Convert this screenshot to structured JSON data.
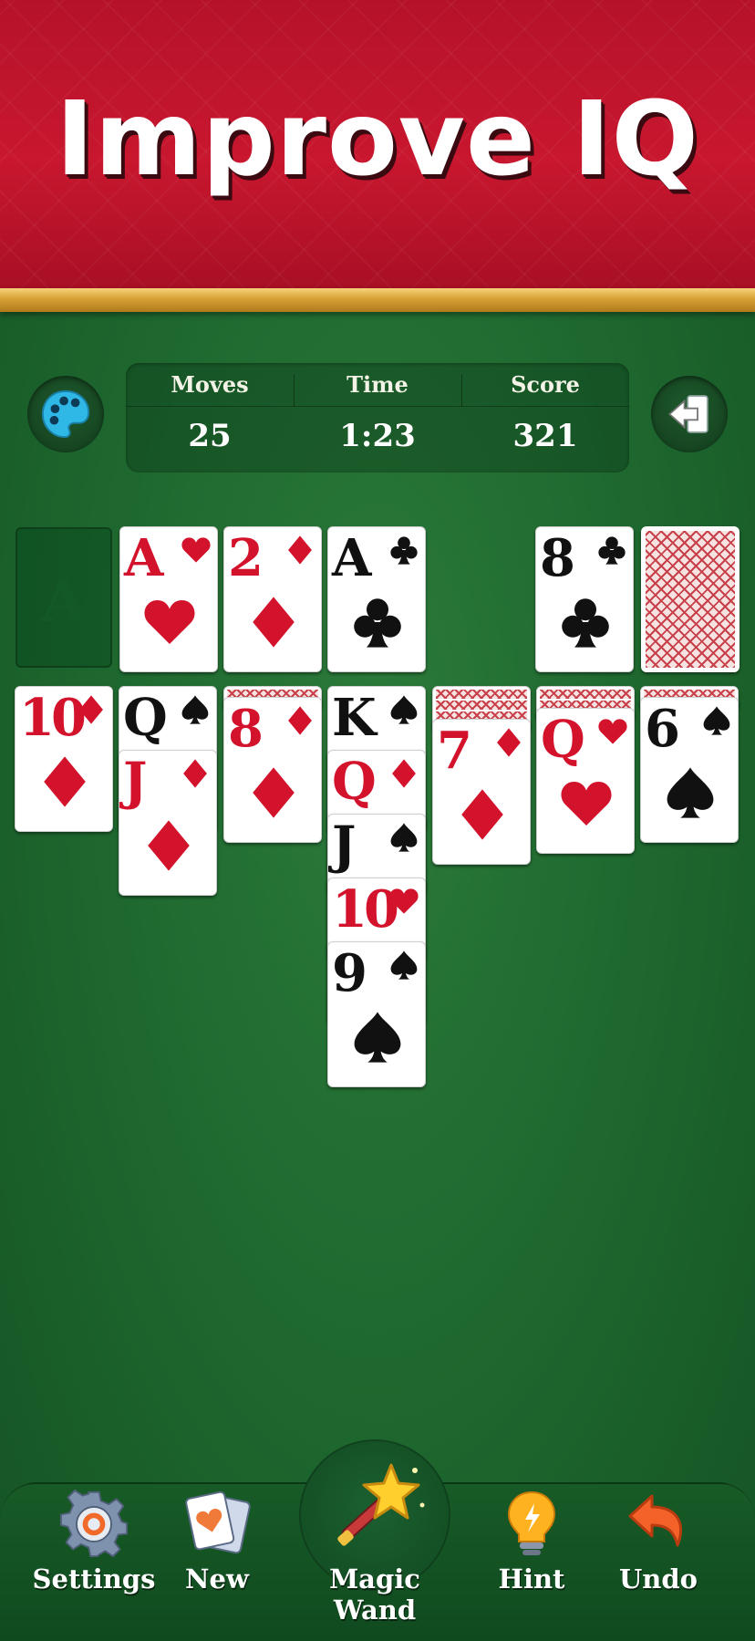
{
  "banner": {
    "title": "Improve IQ"
  },
  "stats": {
    "moves_label": "Moves",
    "moves_value": "25",
    "time_label": "Time",
    "time_value": "1:23",
    "score_label": "Score",
    "score_value": "321"
  },
  "foundation_placeholder": "A",
  "foundations": [
    {
      "rank": "A",
      "suit": "hearts"
    },
    {
      "rank": "2",
      "suit": "diamonds"
    },
    {
      "rank": "A",
      "suit": "clubs"
    }
  ],
  "waste_card": {
    "rank": "8",
    "suit": "clubs"
  },
  "tableau": [
    {
      "column": 1,
      "face_down": 0,
      "cards": [
        {
          "rank": "10",
          "suit": "diamonds"
        }
      ]
    },
    {
      "column": 2,
      "face_down": 0,
      "cards": [
        {
          "rank": "Q",
          "suit": "spades"
        },
        {
          "rank": "J",
          "suit": "diamonds"
        }
      ]
    },
    {
      "column": 3,
      "face_down": 1,
      "cards": [
        {
          "rank": "8",
          "suit": "diamonds"
        }
      ]
    },
    {
      "column": 4,
      "face_down": 0,
      "cards": [
        {
          "rank": "K",
          "suit": "spades"
        },
        {
          "rank": "Q",
          "suit": "diamonds"
        },
        {
          "rank": "J",
          "suit": "spades"
        },
        {
          "rank": "10",
          "suit": "hearts"
        },
        {
          "rank": "9",
          "suit": "spades"
        }
      ]
    },
    {
      "column": 5,
      "face_down": 3,
      "cards": [
        {
          "rank": "7",
          "suit": "diamonds"
        }
      ]
    },
    {
      "column": 6,
      "face_down": 2,
      "cards": [
        {
          "rank": "Q",
          "suit": "hearts"
        }
      ]
    },
    {
      "column": 7,
      "face_down": 1,
      "cards": [
        {
          "rank": "6",
          "suit": "spades"
        }
      ]
    }
  ],
  "toolbar": {
    "settings_label": "Settings",
    "new_label": "New",
    "magic_wand_label": "Magic Wand",
    "hint_label": "Hint",
    "undo_label": "Undo"
  },
  "icons": {
    "theme": "palette-icon",
    "exit": "exit-icon",
    "settings": "gear-icon",
    "new": "cards-icon",
    "magic_wand": "magic-wand-icon",
    "hint": "lightbulb-icon",
    "undo": "undo-arrow-icon"
  },
  "colors": {
    "felt": "#1f6a30",
    "banner_red": "#c8172f",
    "gold": "#d7a034",
    "suit_red": "#d3122c",
    "suit_black": "#111111"
  }
}
